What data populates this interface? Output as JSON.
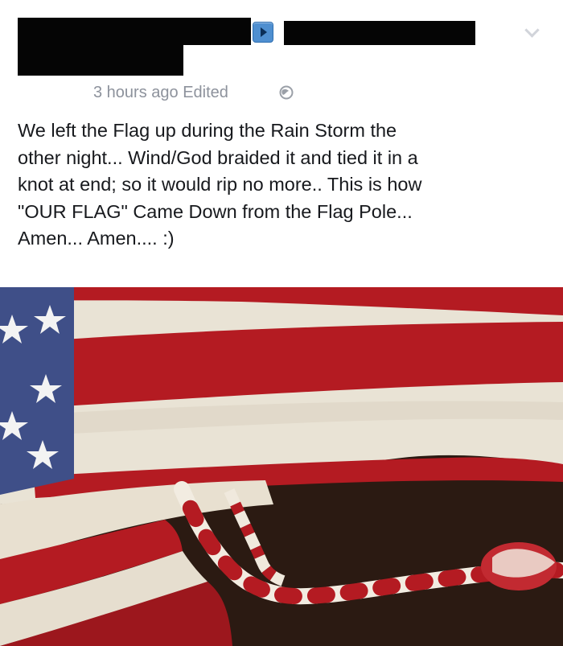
{
  "header": {
    "meta_text": "3 hours ago Edited",
    "icons": [
      "play-arrow-icon",
      "chevron-down-icon",
      "globe-icon"
    ],
    "redacted": [
      "author-name",
      "target-name"
    ]
  },
  "post": {
    "lines": [
      "We left the Flag up during the Rain Storm the",
      "other night...  Wind/God braided it and tied it in a",
      "knot at end; so it would rip no more.. This is how",
      "\"OUR FLAG\" Came Down from the Flag Pole...",
      "Amen... Amen.... :)"
    ]
  },
  "photo": {
    "subject": "flag-photo",
    "colors": {
      "red": "#b41b22",
      "white": "#e9e3d5",
      "blue": "#3f4f88",
      "background": "#2b1a12"
    }
  }
}
